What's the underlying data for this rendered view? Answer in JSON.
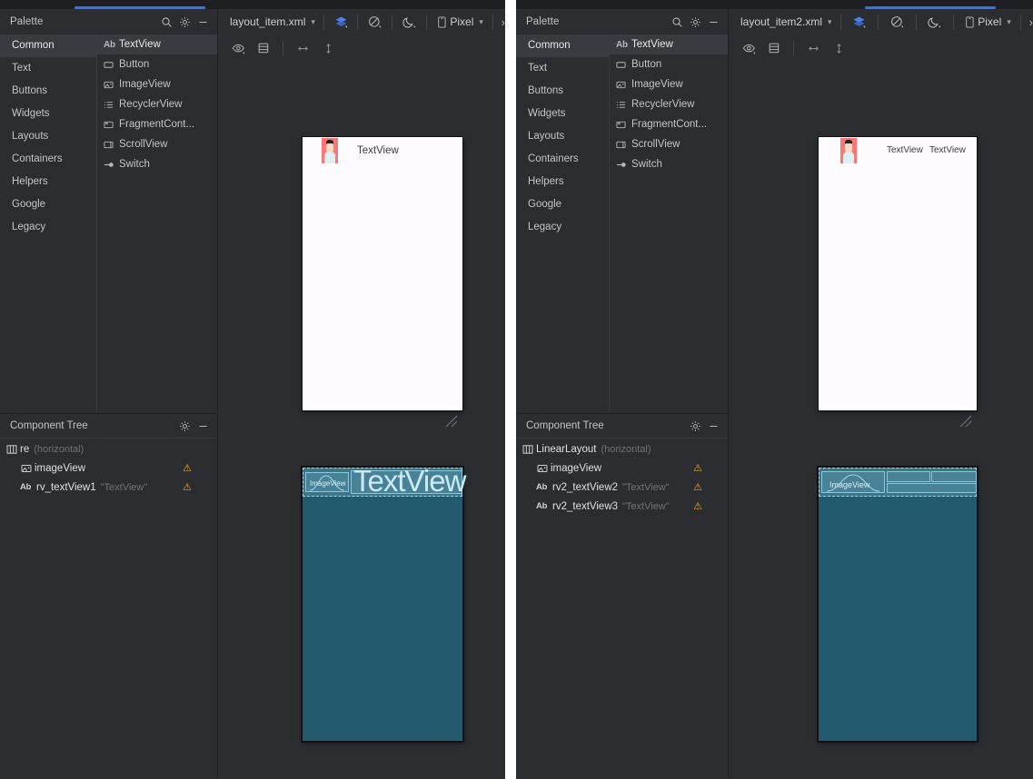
{
  "panels": [
    {
      "id": "left",
      "palette": {
        "title": "Palette",
        "search_icon": "search-icon",
        "settings_icon": "gear-icon",
        "minimize_icon": "minimize-icon",
        "categories": [
          {
            "label": "Common",
            "selected": true
          },
          {
            "label": "Text",
            "selected": false
          },
          {
            "label": "Buttons",
            "selected": false
          },
          {
            "label": "Widgets",
            "selected": false
          },
          {
            "label": "Layouts",
            "selected": false
          },
          {
            "label": "Containers",
            "selected": false
          },
          {
            "label": "Helpers",
            "selected": false
          },
          {
            "label": "Google",
            "selected": false
          },
          {
            "label": "Legacy",
            "selected": false
          }
        ],
        "items": [
          {
            "label": "TextView",
            "icon": "ab-text-icon",
            "selected": true
          },
          {
            "label": "Button",
            "icon": "button-icon",
            "selected": false
          },
          {
            "label": "ImageView",
            "icon": "image-icon",
            "selected": false
          },
          {
            "label": "RecyclerView",
            "icon": "list-icon",
            "selected": false
          },
          {
            "label": "FragmentCont...",
            "icon": "fragment-icon",
            "selected": false
          },
          {
            "label": "ScrollView",
            "icon": "scroll-icon",
            "selected": false
          },
          {
            "label": "Switch",
            "icon": "switch-icon",
            "selected": false
          }
        ]
      },
      "component_tree": {
        "title": "Component Tree",
        "settings_icon": "gear-icon",
        "minimize_icon": "minimize-icon",
        "nodes": [
          {
            "name": "re",
            "meta": "(horizontal)",
            "value": "",
            "icon": "linearlayout-icon",
            "indent": 1,
            "warning": false
          },
          {
            "name": "imageView",
            "meta": "",
            "value": "",
            "icon": "image-icon",
            "indent": 2,
            "warning": true
          },
          {
            "name": "rv_textView1",
            "meta": "",
            "value": "\"TextView\"",
            "icon": "ab-text-icon",
            "indent": 2,
            "warning": true
          }
        ]
      },
      "editor": {
        "file_name": "layout_item.xml",
        "file_chevron": "chevron-down-icon",
        "design_icon": "layers-icon",
        "blueprint_icon": "blueprint-icon",
        "night_icon": "moon-icon",
        "device_icon": "phone-icon",
        "device_name": "Pixel",
        "device_chevron": "chevron-down-icon",
        "overflow_icon": "chevron-right-icon",
        "toolbar2": [
          {
            "icon": "eye-icon"
          },
          {
            "icon": "constraint-list-icon"
          },
          {
            "icon": "horizontal-arrow-icon"
          },
          {
            "icon": "vertical-arrow-icon"
          }
        ]
      },
      "preview": {
        "avatar_name": "avatar-image",
        "text_labels": [
          "TextView"
        ],
        "blueprint_labels": [
          "ImageView",
          "TextView"
        ],
        "resize_handle": "resize-handle-icon"
      },
      "tab_indicator_color": "#3574f0"
    },
    {
      "id": "right",
      "palette": {
        "title": "Palette",
        "search_icon": "search-icon",
        "settings_icon": "gear-icon",
        "minimize_icon": "minimize-icon",
        "categories": [
          {
            "label": "Common",
            "selected": true
          },
          {
            "label": "Text",
            "selected": false
          },
          {
            "label": "Buttons",
            "selected": false
          },
          {
            "label": "Widgets",
            "selected": false
          },
          {
            "label": "Layouts",
            "selected": false
          },
          {
            "label": "Containers",
            "selected": false
          },
          {
            "label": "Helpers",
            "selected": false
          },
          {
            "label": "Google",
            "selected": false
          },
          {
            "label": "Legacy",
            "selected": false
          }
        ],
        "items": [
          {
            "label": "TextView",
            "icon": "ab-text-icon",
            "selected": true
          },
          {
            "label": "Button",
            "icon": "button-icon",
            "selected": false
          },
          {
            "label": "ImageView",
            "icon": "image-icon",
            "selected": false
          },
          {
            "label": "RecyclerView",
            "icon": "list-icon",
            "selected": false
          },
          {
            "label": "FragmentCont...",
            "icon": "fragment-icon",
            "selected": false
          },
          {
            "label": "ScrollView",
            "icon": "scroll-icon",
            "selected": false
          },
          {
            "label": "Switch",
            "icon": "switch-icon",
            "selected": false
          }
        ]
      },
      "component_tree": {
        "title": "Component Tree",
        "settings_icon": "gear-icon",
        "minimize_icon": "minimize-icon",
        "nodes": [
          {
            "name": "LinearLayout",
            "meta": "(horizontal)",
            "value": "",
            "icon": "linearlayout-icon",
            "indent": 1,
            "warning": false
          },
          {
            "name": "imageView",
            "meta": "",
            "value": "",
            "icon": "image-icon",
            "indent": 2,
            "warning": true
          },
          {
            "name": "rv2_textView2",
            "meta": "",
            "value": "\"TextView\"",
            "icon": "ab-text-icon",
            "indent": 2,
            "warning": true
          },
          {
            "name": "rv2_textView3",
            "meta": "",
            "value": "\"TextView\"",
            "icon": "ab-text-icon",
            "indent": 2,
            "warning": true
          }
        ]
      },
      "editor": {
        "file_name": "layout_item2.xml",
        "file_chevron": "chevron-down-icon",
        "design_icon": "layers-icon",
        "blueprint_icon": "blueprint-icon",
        "night_icon": "moon-icon",
        "device_icon": "phone-icon",
        "device_name": "Pixel",
        "device_chevron": "chevron-down-icon",
        "overflow_icon": "chevron-right-icon",
        "toolbar2": [
          {
            "icon": "eye-icon"
          },
          {
            "icon": "constraint-list-icon"
          },
          {
            "icon": "horizontal-arrow-icon"
          },
          {
            "icon": "vertical-arrow-icon"
          }
        ]
      },
      "preview": {
        "avatar_name": "avatar-image",
        "text_labels": [
          "TextView",
          "TextView"
        ],
        "blueprint_labels": [
          "ImageView"
        ],
        "resize_handle": "resize-handle-icon"
      },
      "tab_indicator_color": "#3574f0"
    }
  ],
  "colors": {
    "panel_bg": "#2b2d30",
    "panel_alt": "#393b40",
    "border": "#1e1f22",
    "text": "#c3c5c8",
    "muted": "#6f737a",
    "accent": "#3574f0",
    "warning": "#f0a732",
    "blueprint_bg": "#245a6e",
    "blueprint_line": "#86c8de",
    "avatar_bg": "#fb7676"
  }
}
